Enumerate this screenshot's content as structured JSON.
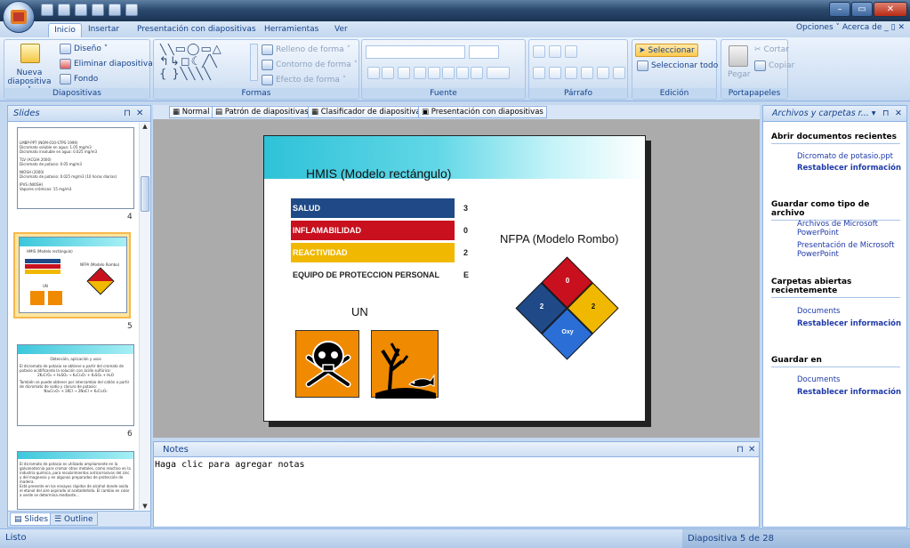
{
  "tabs": [
    "Inicio",
    "Insertar",
    "Presentación con diapositivas",
    "Herramientas",
    "Ver"
  ],
  "menu_right": "Opciones ˅ Acerca de _ ▯ ✕",
  "ribbon": {
    "diapositivas": {
      "nueva": "Nueva diapositiva ˅",
      "diseno": "Diseño ˅",
      "eliminar": "Eliminar diapositiva",
      "fondo": "Fondo",
      "title": "Diapositivas"
    },
    "formas": {
      "relleno": "Relleno de forma ˅",
      "contorno": "Contorno de forma ˅",
      "efecto": "Efecto de forma ˅",
      "title": "Formas"
    },
    "fuente": {
      "title": "Fuente"
    },
    "parrafo": {
      "title": "Párrafo"
    },
    "edicion": {
      "seleccionar": "Seleccionar",
      "seleccionar_todo": "Seleccionar todo",
      "title": "Edición"
    },
    "portapapeles": {
      "pegar": "Pegar",
      "cortar": "Cortar",
      "copiar": "Copiar",
      "title": "Portapapeles"
    }
  },
  "left_pane": {
    "title": "Slides",
    "tab_slides": "Slides",
    "tab_outline": "Outline",
    "numbers": [
      "4",
      "5",
      "6"
    ]
  },
  "thumb4": [
    "LMBP-PPT (NOM-010-STPS-1999)",
    "Dicromato soluble en agua: 1.05 mg/m3",
    "Dicromato insoluble en agua: 0.025 mg/m3",
    "",
    "TLV (ACGIH 2000)",
    "Dicromato de potasio: 0.05 mg/m3",
    "",
    "NIOSH (2000)",
    "Dicromato de potasio: 0.025 mg/m3 (10 horas diarias)",
    "",
    "IPVS (NIOSH)",
    "Vapores crómicos: 15 mg/m3"
  ],
  "thumb5": {
    "hmis": "HMIS (Modelo rectángulo)",
    "nfpa": "NFPA (Modelo Rombo)",
    "un": "UN"
  },
  "thumb6": [
    "Obtención, aplicación y usos",
    "",
    "El dicromato de potasio se obtiene a partir del cromato de potasio acidificando la solución con ácido sulfúrico:",
    "2K₂CrO₄ + H₂SO₄ → K₂Cr₂O₇ + K₂SO₄ + H₂O",
    "",
    "También se puede obtener por intercambio del catión a partir de dicromato de sodio y cloruro de potasio:",
    "Na₂Cr₂O₇ + 2KCl → 2NaCl + K₂Cr₂O₇"
  ],
  "thumb7": [
    "El dicromato de potasio es utilizado ampliamente en la galvanotecnia para cromar otros metales, como reactivo en la industria química, para recubrimientos anticorrosivos del zinc y del magnesio y en algunos preparados de protección de madera.",
    "Está presente en los ensayos rápidos de alcohol donde oxida el etanol del aire aspirado al acetaldehído. El cambio en color a verde se determina mediante..."
  ],
  "view_tabs": {
    "normal": "Normal",
    "patron": "Patrón de diapositivas",
    "clasificador": "Clasificador de diapositivas",
    "presentacion": "Presentación con diapositivas"
  },
  "slide": {
    "hmis_title": "HMIS (Modelo rectángulo)",
    "rows": [
      {
        "label": "SALUD",
        "value": "3",
        "color": "#1f4a87"
      },
      {
        "label": "INFLAMABILIDAD",
        "value": "0",
        "color": "#c8101e"
      },
      {
        "label": "REACTIVIDAD",
        "value": "2",
        "color": "#f0b800"
      },
      {
        "label": "EQUIPO DE PROTECCION PERSONAL",
        "value": "E",
        "color": "#ffffff"
      }
    ],
    "nfpa_title": "NFPA (Modelo Rombo)",
    "diamond": {
      "top": "0",
      "left": "2",
      "right": "2",
      "bottom": "Oxy"
    },
    "un_label": "UN"
  },
  "notes": {
    "title": "Notes",
    "placeholder": "Haga clic para agregar notas"
  },
  "right_pane": {
    "title": "Archivos y carpetas r... ▾",
    "sec1": "Abrir documentos recientes",
    "link1": "Dicromato de potasio.ppt",
    "restablecer": "Restablecer información",
    "sec2": "Guardar como tipo de archivo",
    "link2": "Archivos de Microsoft PowerPoint",
    "link3": "Presentación de Microsoft PowerPoint",
    "sec3": "Carpetas abiertas recientemente",
    "documents": "Documents",
    "sec4": "Guardar en"
  },
  "status": {
    "left": "Listo",
    "right": "Diapositiva 5 de 28"
  }
}
